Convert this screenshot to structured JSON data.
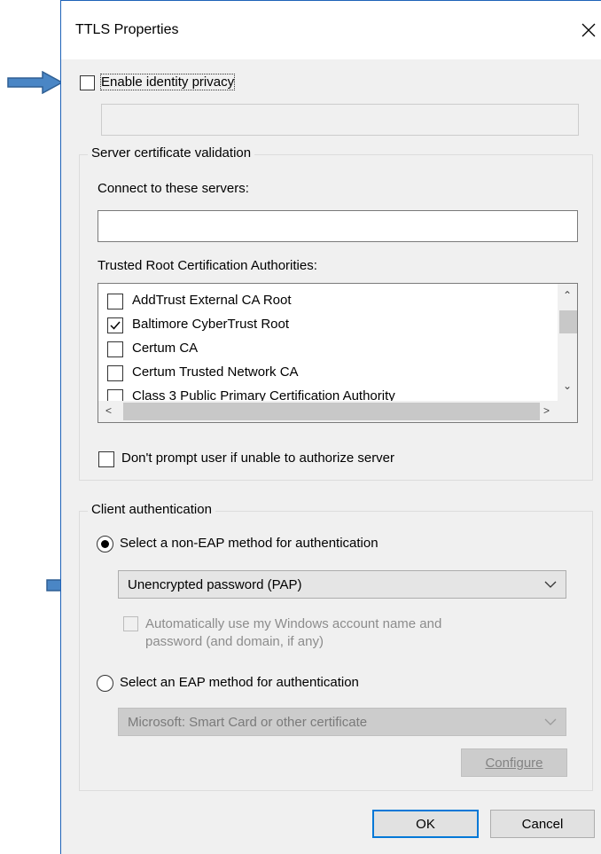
{
  "window": {
    "title": "TTLS Properties",
    "close_icon": "close-icon"
  },
  "identity_privacy": {
    "label": "Enable identity privacy",
    "checked": false,
    "value": ""
  },
  "server_validation": {
    "group_title": "Server certificate validation",
    "connect_label": "Connect to these servers:",
    "connect_value": "",
    "trusted_root_label": "Trusted Root Certification Authorities:",
    "authorities": [
      {
        "name": "AddTrust External CA Root",
        "checked": false
      },
      {
        "name": "Baltimore CyberTrust Root",
        "checked": true
      },
      {
        "name": "Certum CA",
        "checked": false
      },
      {
        "name": "Certum Trusted Network CA",
        "checked": false
      },
      {
        "name": "Class 3 Public Primary Certification Authority",
        "checked": false
      }
    ],
    "dont_prompt_label": "Don't prompt user if unable to authorize server",
    "dont_prompt_checked": false
  },
  "client_auth": {
    "group_title": "Client authentication",
    "non_eap_label": "Select a non-EAP method for authentication",
    "non_eap_selected": true,
    "non_eap_method": "Unencrypted password (PAP)",
    "auto_windows_line1": "Automatically use my Windows account name and",
    "auto_windows_line2": "password (and domain, if any)",
    "eap_label": "Select an EAP method for authentication",
    "eap_method": "Microsoft: Smart Card or other certificate",
    "configure_label": "Configure"
  },
  "footer": {
    "ok_label": "OK",
    "cancel_label": "Cancel"
  },
  "colors": {
    "arrow_fill": "#4a86c5",
    "arrow_stroke": "#2f5f93",
    "focus_border": "#0078d7"
  }
}
